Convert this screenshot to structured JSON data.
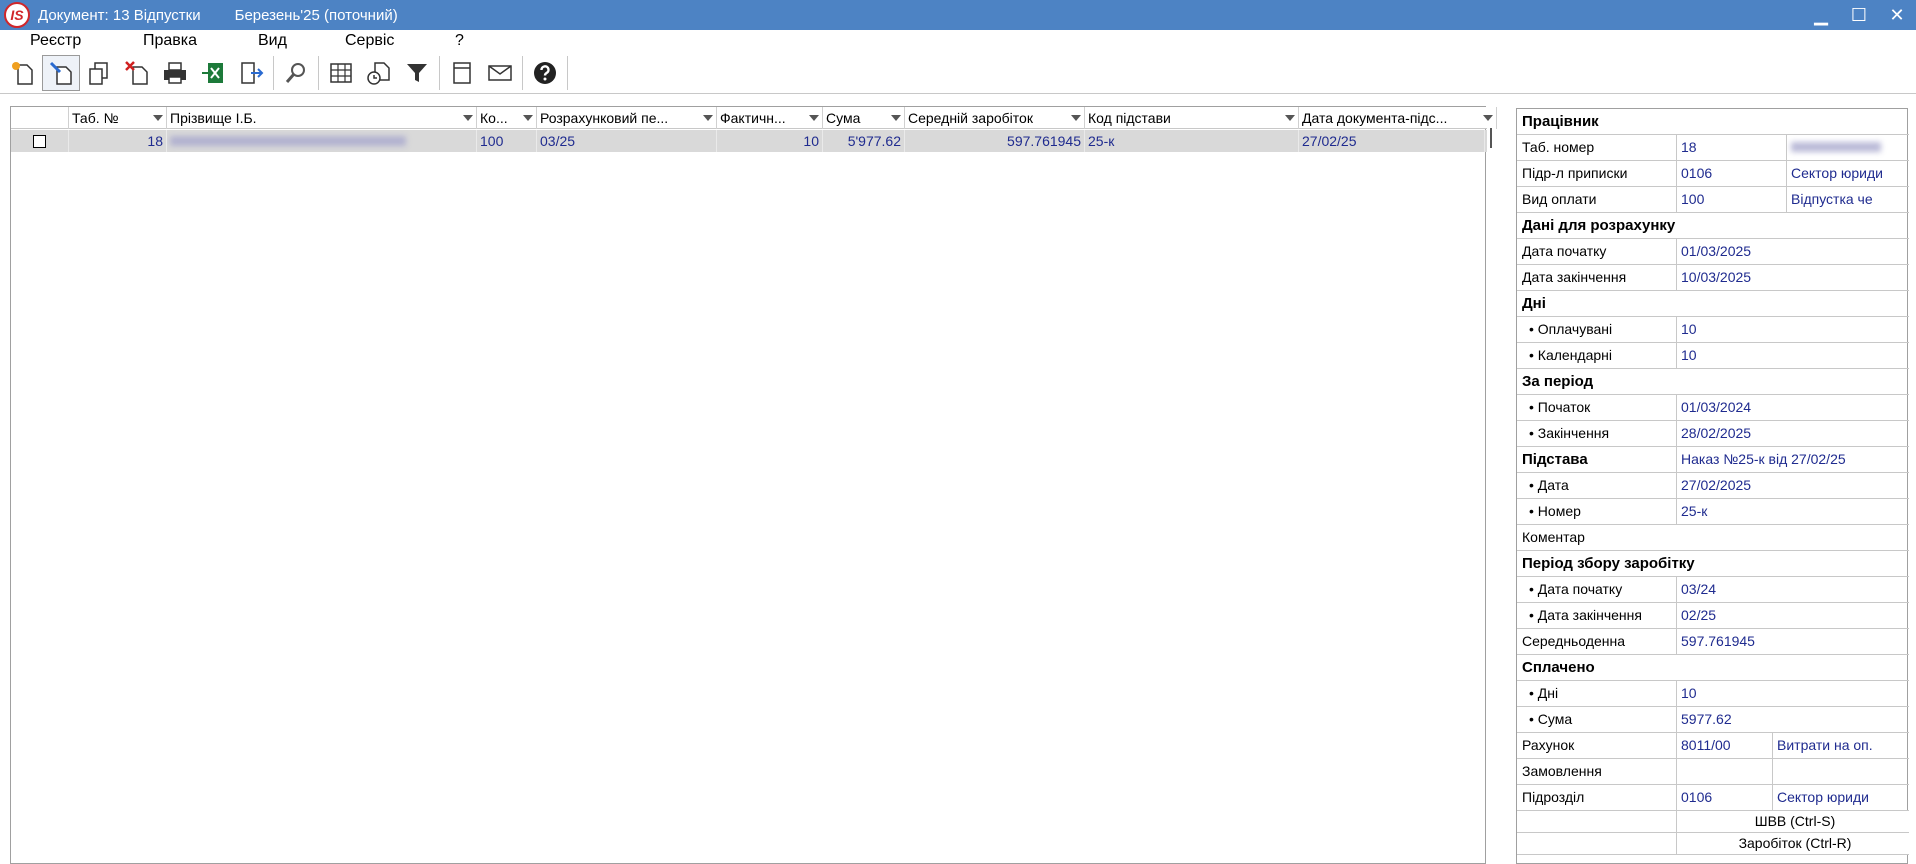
{
  "window": {
    "app_logo": "IS",
    "title": "Документ: 13 Відпустки",
    "period": "Березень'25 (поточний)",
    "min_label": "▁",
    "max_label": "☐",
    "close_label": "✕"
  },
  "menu": [
    {
      "label": "Реєстр"
    },
    {
      "label": "Правка"
    },
    {
      "label": "Вид"
    },
    {
      "label": "Сервіс"
    },
    {
      "label": "?"
    }
  ],
  "toolbar_icons": [
    "new-doc-icon",
    "edit-icon",
    "copy-icon",
    "delete-icon",
    "print-icon",
    "excel-export-icon",
    "exit-icon",
    "search-icon",
    "grid-view-icon",
    "history-icon",
    "filter-icon",
    "card-icon",
    "mail-icon",
    "help-icon"
  ],
  "grid": {
    "columns": [
      {
        "label": ""
      },
      {
        "label": "Таб. №"
      },
      {
        "label": "Прізвище І.Б."
      },
      {
        "label": "Ко..."
      },
      {
        "label": "Розрахунковий пе..."
      },
      {
        "label": "Фактичн..."
      },
      {
        "label": "Сума"
      },
      {
        "label": "Середній заробіток"
      },
      {
        "label": "Код підстави"
      },
      {
        "label": "Дата документа-підс..."
      }
    ],
    "rows": [
      {
        "tab_no": "18",
        "code": "100",
        "calc_period": "03/25",
        "actual": "10",
        "sum": "5'977.62",
        "avg_salary": "597.761945",
        "basis_code": "25-к",
        "doc_date": "27/02/25"
      }
    ]
  },
  "panel": {
    "employee_section": "Працівник",
    "tab_no_label": "Таб. номер",
    "tab_no_value": "18",
    "dept_label": "Підр-л приписки",
    "dept_code": "0106",
    "dept_name": "Сектор юриди",
    "pay_type_label": "Вид оплати",
    "pay_type_code": "100",
    "pay_type_name": "Відпустка че",
    "calc_section": "Дані для розрахунку",
    "start_label": "Дата початку",
    "start_value": "01/03/2025",
    "end_label": "Дата закінчення",
    "end_value": "10/03/2025",
    "days_section": "Дні",
    "paid_label": "• Оплачувані",
    "paid_value": "10",
    "calendar_label": "• Календарні",
    "calendar_value": "10",
    "period_section": "За період",
    "period_start_label": "• Початок",
    "period_start_value": "01/03/2024",
    "period_end_label": "• Закінчення",
    "period_end_value": "28/02/2025",
    "basis_label": "Підстава",
    "basis_value": "Наказ №25-к від 27/02/25",
    "basis_date_label": "• Дата",
    "basis_date_value": "27/02/2025",
    "basis_no_label": "• Номер",
    "basis_no_value": "25-к",
    "comment_label": "Коментар",
    "earn_section": "Період збору заробітку",
    "earn_start_label": "• Дата початку",
    "earn_start_value": "03/24",
    "earn_end_label": "• Дата закінчення",
    "earn_end_value": "02/25",
    "daily_avg_label": "Середньоденна",
    "daily_avg_value": "597.761945",
    "paid_section": "Сплачено",
    "paid_days_label": "• Дні",
    "paid_days_value": "10",
    "paid_sum_label": "• Сума",
    "paid_sum_value": "5977.62",
    "account_label": "Рахунок",
    "account_code": "8011/00",
    "account_name": "Витрати на оп.",
    "order_label": "Замовлення",
    "subdiv_label": "Підрозділ",
    "subdiv_code": "0106",
    "subdiv_name": "Сектор юриди",
    "shvv_button": "ШВВ (Ctrl-S)",
    "earnings_button": "Заробіток (Ctrl-R)"
  }
}
